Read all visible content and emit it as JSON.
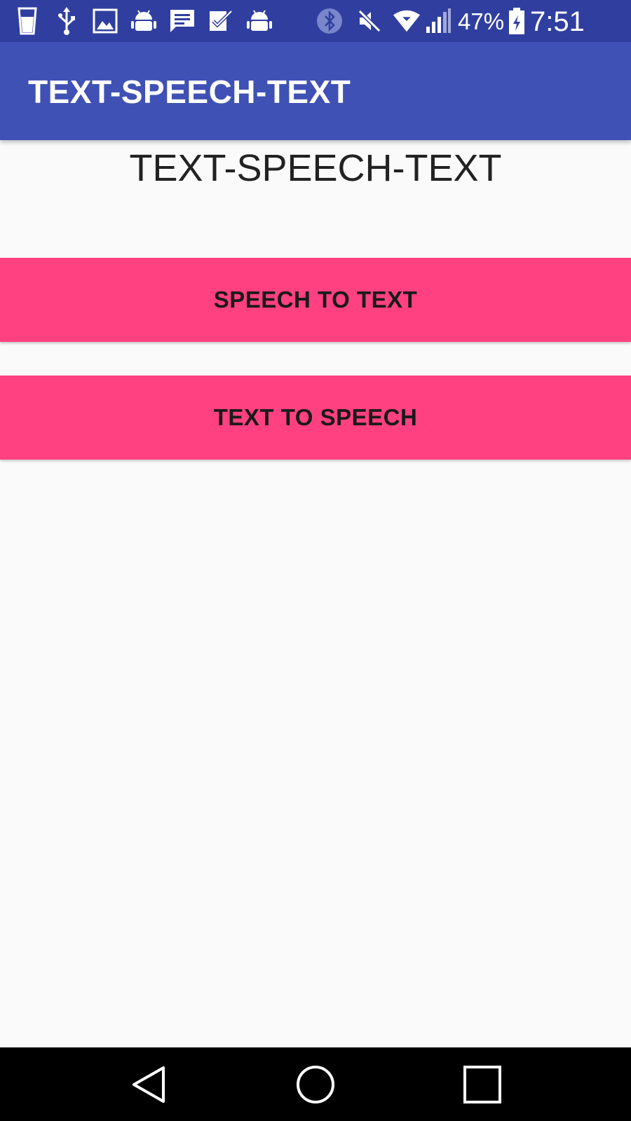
{
  "status_bar": {
    "left_icons": [
      "cup-icon",
      "usb-icon",
      "image-icon",
      "android-icon",
      "message-icon",
      "check-icon",
      "android-icon"
    ],
    "right_icons": [
      "bluetooth-icon",
      "mute-icon",
      "wifi-icon",
      "signal-icon",
      "battery-icon"
    ],
    "battery_percent": "47%",
    "time": "7:51 PM",
    "background_color": "#303f9f"
  },
  "app_bar": {
    "title": "TEXT-SPEECH-TEXT",
    "background_color": "#3f51b5"
  },
  "main": {
    "heading": "TEXT-SPEECH-TEXT",
    "buttons": [
      {
        "label": "SPEECH TO TEXT"
      },
      {
        "label": "TEXT TO SPEECH"
      }
    ],
    "button_color": "#ff4081"
  },
  "nav_bar": {
    "buttons": [
      "back-icon",
      "home-icon",
      "recents-icon"
    ]
  }
}
